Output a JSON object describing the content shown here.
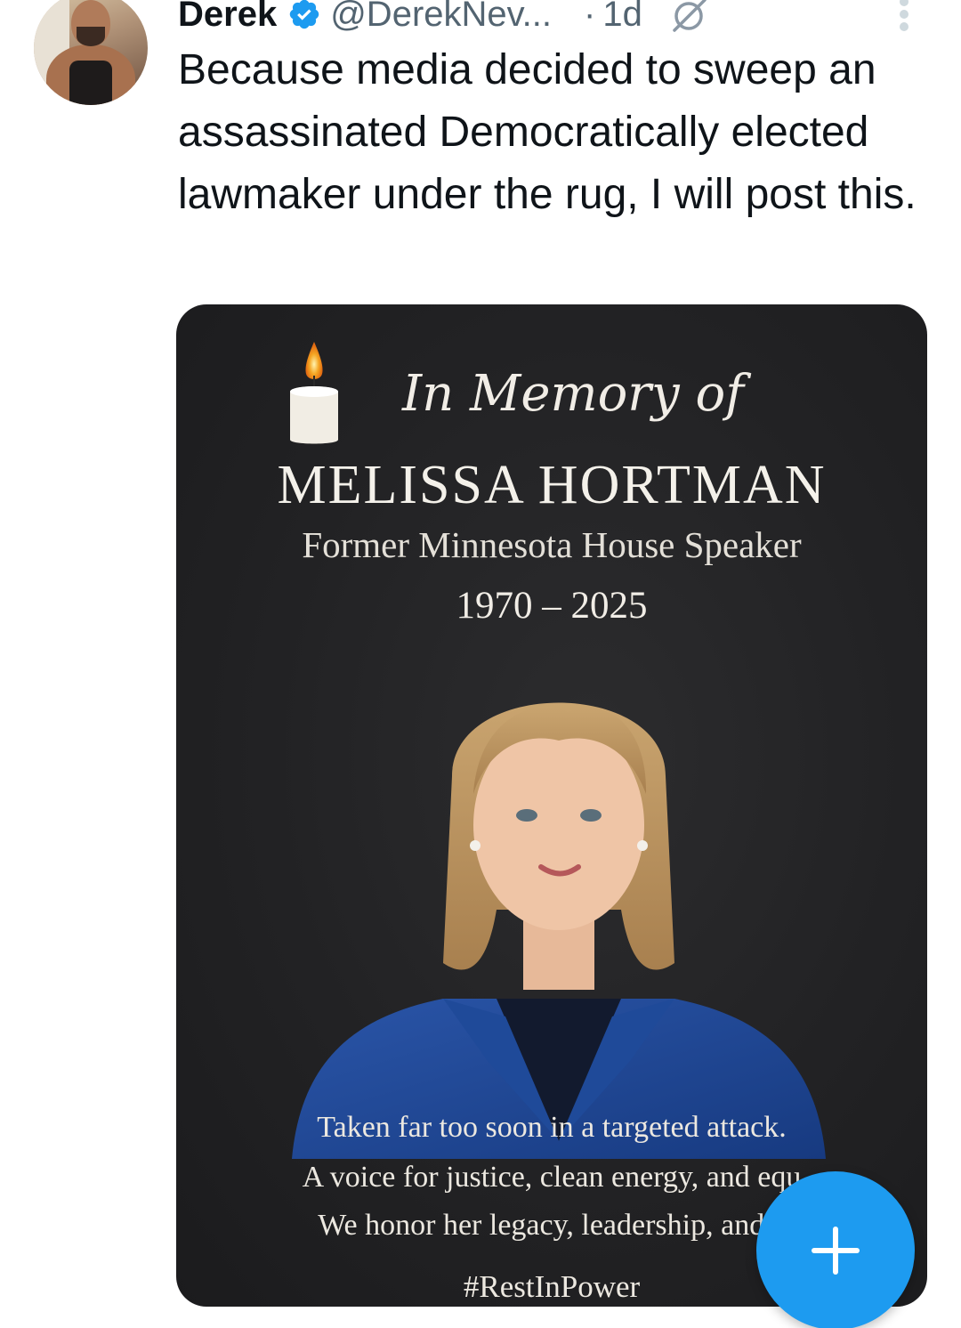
{
  "post": {
    "author_name": "Derek",
    "handle": "@DerekNev...",
    "separator": "·",
    "timestamp": "1d",
    "verified": true,
    "text": "Because media decided to sweep an assassinated Democratically elected lawmaker under the rug, I will post this."
  },
  "media": {
    "heading": "In Memory of",
    "name": "MELISSA HORTMAN",
    "role": "Former Minnesota House Speaker",
    "years": "1970 – 2025",
    "caption_lines": [
      "Taken far too soon in a targeted attack.",
      "A voice for justice, clean energy, and equ",
      "We honor her legacy, leadership, and c"
    ],
    "hashtag": "#RestInPower"
  },
  "icons": {
    "verified": "verified-badge-icon",
    "grok": "grok-icon",
    "more": "more-vertical-icon",
    "compose": "plus-icon",
    "candle": "candle-icon"
  },
  "colors": {
    "accent": "#1d9bf0",
    "text": "#0f1419",
    "secondary": "#536471",
    "media_bg": "#222224"
  }
}
